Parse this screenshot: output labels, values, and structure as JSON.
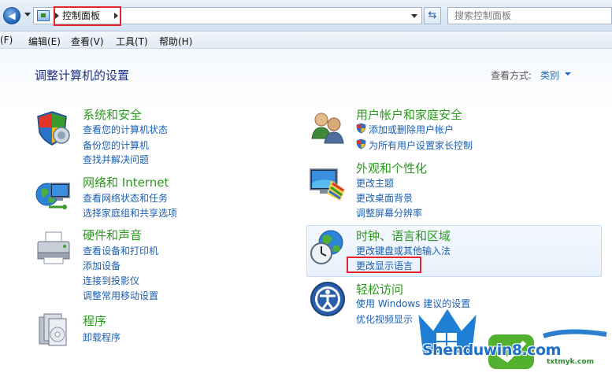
{
  "address_bar": {
    "breadcrumb": "控制面板",
    "search_placeholder": "搜索控制面板"
  },
  "menu": [
    "文件(F)",
    "编辑(E)",
    "查看(V)",
    "工具(T)",
    "帮助(H)"
  ],
  "menu_display": [
    "(F)",
    "编辑(E)",
    "查看(V)",
    "工具(T)",
    "帮助(H)"
  ],
  "page": {
    "title": "调整计算机的设置",
    "view_by_label": "查看方式:",
    "view_by_value": "类别"
  },
  "categories": {
    "system_security": {
      "title": "系统和安全",
      "links": [
        "查看您的计算机状态",
        "备份您的计算机",
        "查找并解决问题"
      ]
    },
    "network": {
      "title": "网络和 Internet",
      "links": [
        "查看网络状态和任务",
        "选择家庭组和共享选项"
      ]
    },
    "hardware": {
      "title": "硬件和声音",
      "links": [
        "查看设备和打印机",
        "添加设备",
        "连接到投影仪",
        "调整常用移动设置"
      ]
    },
    "programs": {
      "title": "程序",
      "links": [
        "卸载程序"
      ]
    },
    "user_accounts": {
      "title": "用户帐户和家庭安全",
      "links": [
        "添加或删除用户帐户",
        "为所有用户设置家长控制"
      ]
    },
    "appearance": {
      "title": "外观和个性化",
      "links": [
        "更改主题",
        "更改桌面背景",
        "调整屏幕分辨率"
      ]
    },
    "clock_region": {
      "title": "时钟、语言和区域",
      "links": [
        "更改键盘或其他输入法",
        "更改显示语言"
      ]
    },
    "ease_access": {
      "title": "轻松访问",
      "links": [
        "使用 Windows 建议的设置",
        "优化视频显示"
      ]
    }
  },
  "watermark": {
    "text": "Shenduwin8.com",
    "sub": "txtmyk.com"
  },
  "colors": {
    "category_title": "#2a9a1c",
    "link": "#1a5fb4",
    "page_title": "#1e3287",
    "highlight_box": "#e8242b"
  }
}
